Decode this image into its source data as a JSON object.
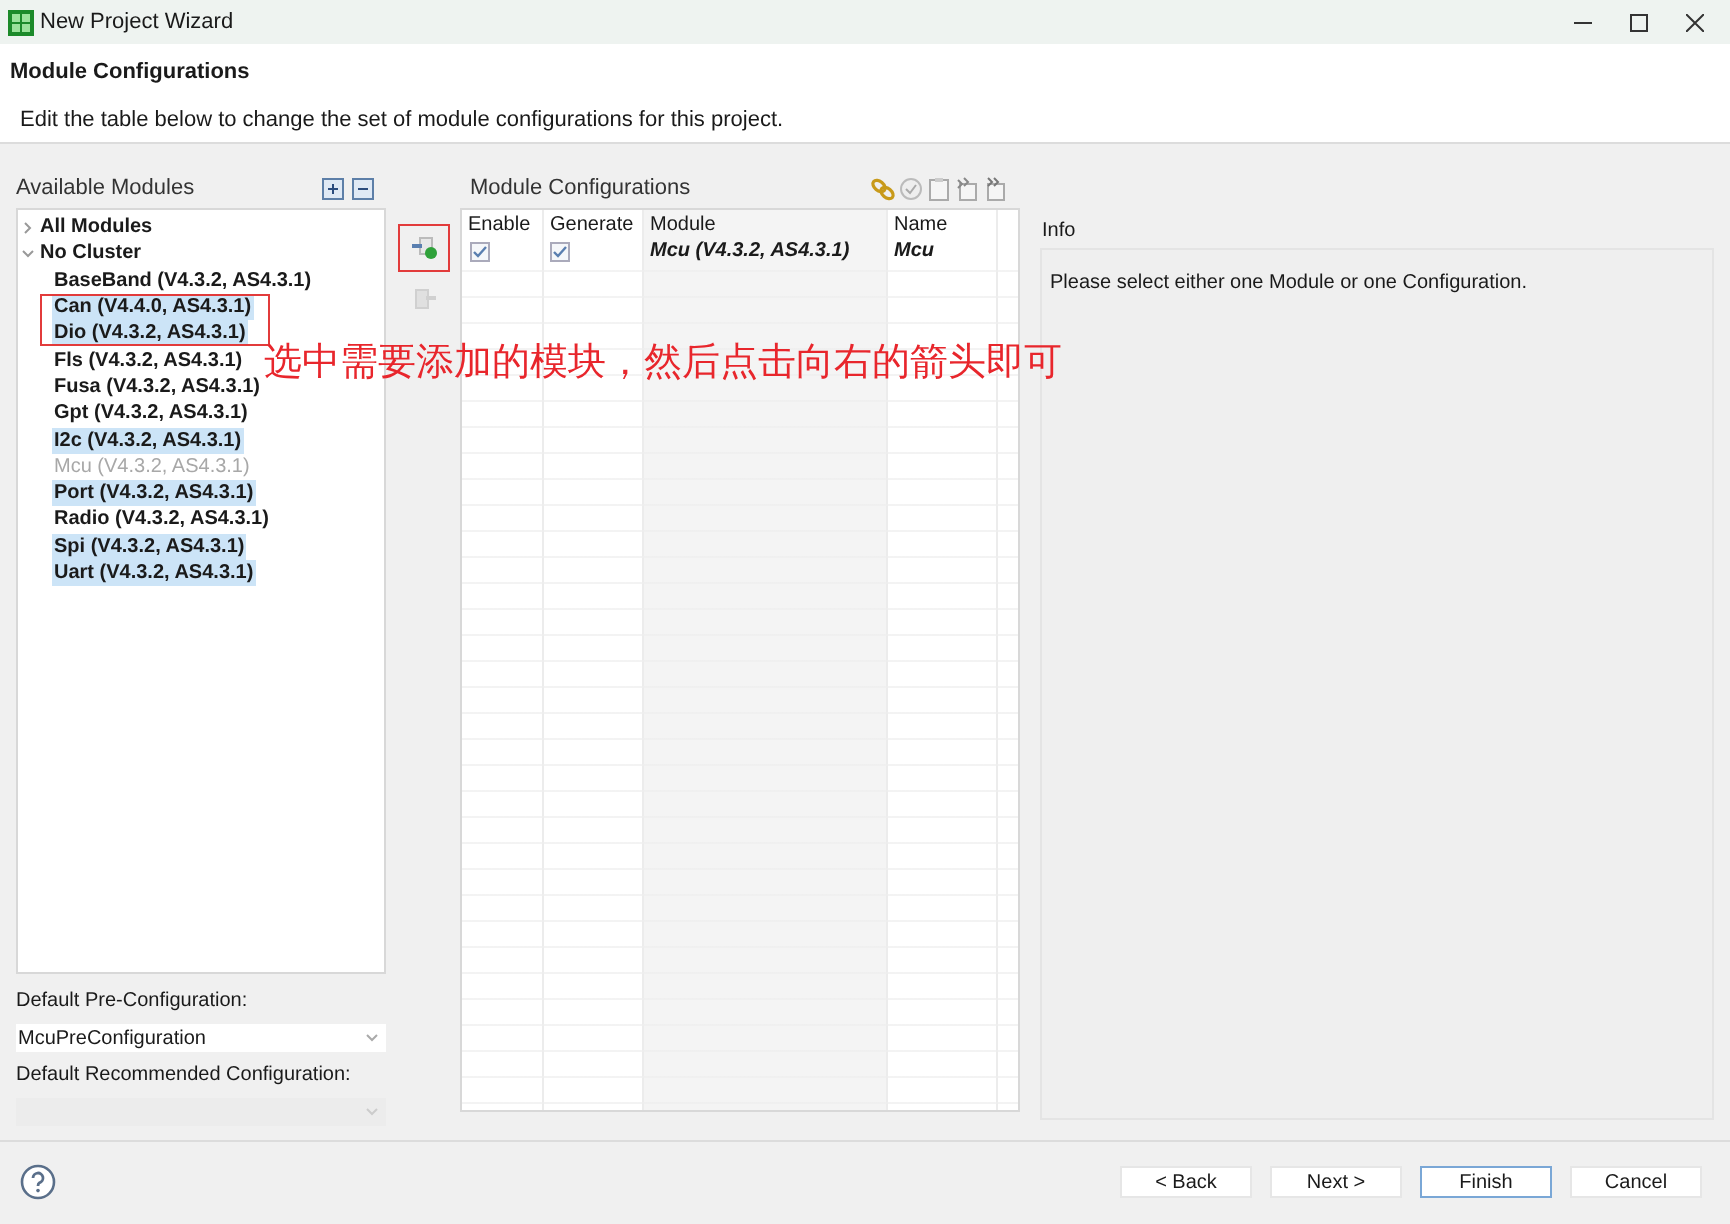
{
  "window": {
    "title": "New Project Wizard"
  },
  "header": {
    "title": "Module Configurations",
    "description": "Edit the table below to change the set of module configurations for this project."
  },
  "available_modules": {
    "label": "Available Modules",
    "tree": [
      {
        "label": "All Modules",
        "expanded": false
      },
      {
        "label": "No Cluster",
        "expanded": true,
        "children": [
          {
            "label": "BaseBand (V4.3.2, AS4.3.1)",
            "selected": false,
            "disabled": false
          },
          {
            "label": "Can (V4.4.0, AS4.3.1)",
            "selected": true,
            "disabled": false
          },
          {
            "label": "Dio (V4.3.2, AS4.3.1)",
            "selected": true,
            "disabled": false
          },
          {
            "label": "Fls (V4.3.2, AS4.3.1)",
            "selected": false,
            "disabled": false
          },
          {
            "label": "Fusa (V4.3.2, AS4.3.1)",
            "selected": false,
            "disabled": false
          },
          {
            "label": "Gpt (V4.3.2, AS4.3.1)",
            "selected": false,
            "disabled": false
          },
          {
            "label": "I2c (V4.3.2, AS4.3.1)",
            "selected": true,
            "disabled": false
          },
          {
            "label": "Mcu (V4.3.2, AS4.3.1)",
            "selected": false,
            "disabled": true
          },
          {
            "label": "Port (V4.3.2, AS4.3.1)",
            "selected": true,
            "disabled": false
          },
          {
            "label": "Radio (V4.3.2, AS4.3.1)",
            "selected": false,
            "disabled": false
          },
          {
            "label": "Spi (V4.3.2, AS4.3.1)",
            "selected": true,
            "disabled": false
          },
          {
            "label": "Uart (V4.3.2, AS4.3.1)",
            "selected": true,
            "disabled": false
          }
        ]
      }
    ]
  },
  "transfer_buttons": [
    {
      "kind": "add",
      "disabled": false
    },
    {
      "kind": "remove",
      "disabled": true
    }
  ],
  "pre_configuration": {
    "label": "Default Pre-Configuration:",
    "value": "McuPreConfiguration"
  },
  "recommended_configuration": {
    "label": "Default Recommended Configuration:",
    "disabled": true
  },
  "module_configurations": {
    "label": "Module Configurations",
    "columns": [
      "Enable",
      "Generate",
      "Module",
      "Name"
    ],
    "rows": [
      {
        "enable": true,
        "generate": true,
        "module": "Mcu (V4.3.2, AS4.3.1)",
        "name": "Mcu"
      }
    ]
  },
  "info": {
    "title": "Info",
    "message": "Please select either one Module or one Configuration."
  },
  "annotation": {
    "text": "选中需要添加的模块，然后点击向右的箭头即可"
  },
  "buttons": [
    {
      "label": "< Back",
      "default": false
    },
    {
      "label": "Next >",
      "default": false
    },
    {
      "label": "Finish",
      "default": true
    },
    {
      "label": "Cancel",
      "default": false
    }
  ]
}
